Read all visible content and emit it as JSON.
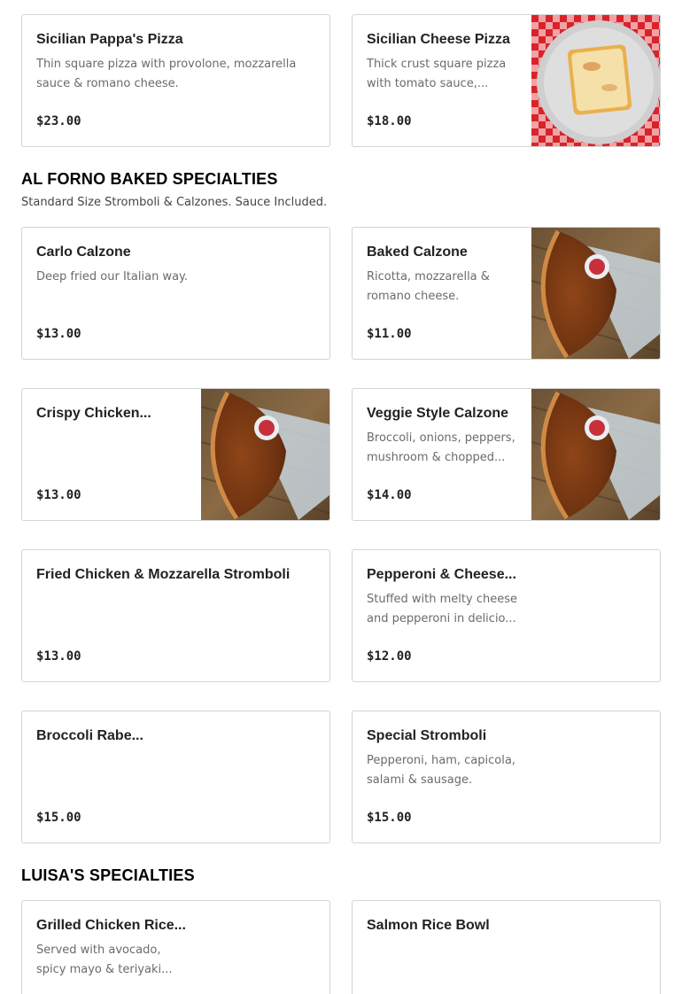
{
  "top_items": [
    {
      "name": "Sicilian Pappa's Pizza",
      "desc": "Thin square pizza with provolone, mozzarella sauce & romano cheese.",
      "price": "$23.00"
    },
    {
      "name": "Sicilian Cheese Pizza",
      "desc": "Thick crust square pizza with tomato sauce,...",
      "price": "$18.00",
      "image": "pizza-slice-image"
    }
  ],
  "al_forno": {
    "title": "AL FORNO BAKED SPECIALTIES",
    "subtitle": "Standard Size Stromboli & Calzones. Sauce Included.",
    "items": [
      {
        "name": "Carlo Calzone",
        "desc": "Deep fried our Italian way.",
        "price": "$13.00"
      },
      {
        "name": "Baked Calzone",
        "desc": "Ricotta, mozzarella & romano cheese.",
        "price": "$11.00",
        "image": "calzone-image"
      },
      {
        "name": "Crispy Chicken...",
        "desc": "",
        "price": "$13.00",
        "image": "calzone-image"
      },
      {
        "name": "Veggie Style Calzone",
        "desc": "Broccoli, onions, peppers, mushroom & chopped...",
        "price": "$14.00",
        "image": "calzone-image"
      },
      {
        "name": "Fried Chicken & Mozzarella Stromboli",
        "desc": "",
        "price": "$13.00"
      },
      {
        "name": "Pepperoni & Cheese...",
        "desc": "Stuffed with melty cheese and pepperoni in delicio...",
        "price": "$12.00"
      },
      {
        "name": "Broccoli Rabe...",
        "desc": "",
        "price": "$15.00"
      },
      {
        "name": "Special Stromboli",
        "desc": "Pepperoni, ham, capicola, salami & sausage.",
        "price": "$15.00"
      }
    ]
  },
  "luisas": {
    "title": "LUISA'S SPECIALTIES",
    "items": [
      {
        "name": "Grilled Chicken Rice...",
        "desc": "Served with avocado, spicy mayo & teriyaki..."
      },
      {
        "name": "Salmon Rice Bowl",
        "desc": ""
      }
    ]
  }
}
